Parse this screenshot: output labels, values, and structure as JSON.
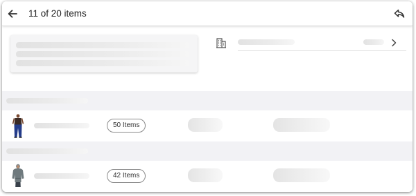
{
  "header": {
    "title": "11 of 20 items",
    "back_icon": "arrow-left-icon",
    "reply_icon": "reply-icon"
  },
  "summary": {
    "building_icon": "building-icon",
    "chevron_icon": "chevron-right-icon"
  },
  "groups": [
    {
      "item_count_label": "50 Items",
      "thumbnail": "jeans-product-thumbnail"
    },
    {
      "item_count_label": "42 Items",
      "thumbnail": "hoodie-product-thumbnail"
    }
  ]
}
